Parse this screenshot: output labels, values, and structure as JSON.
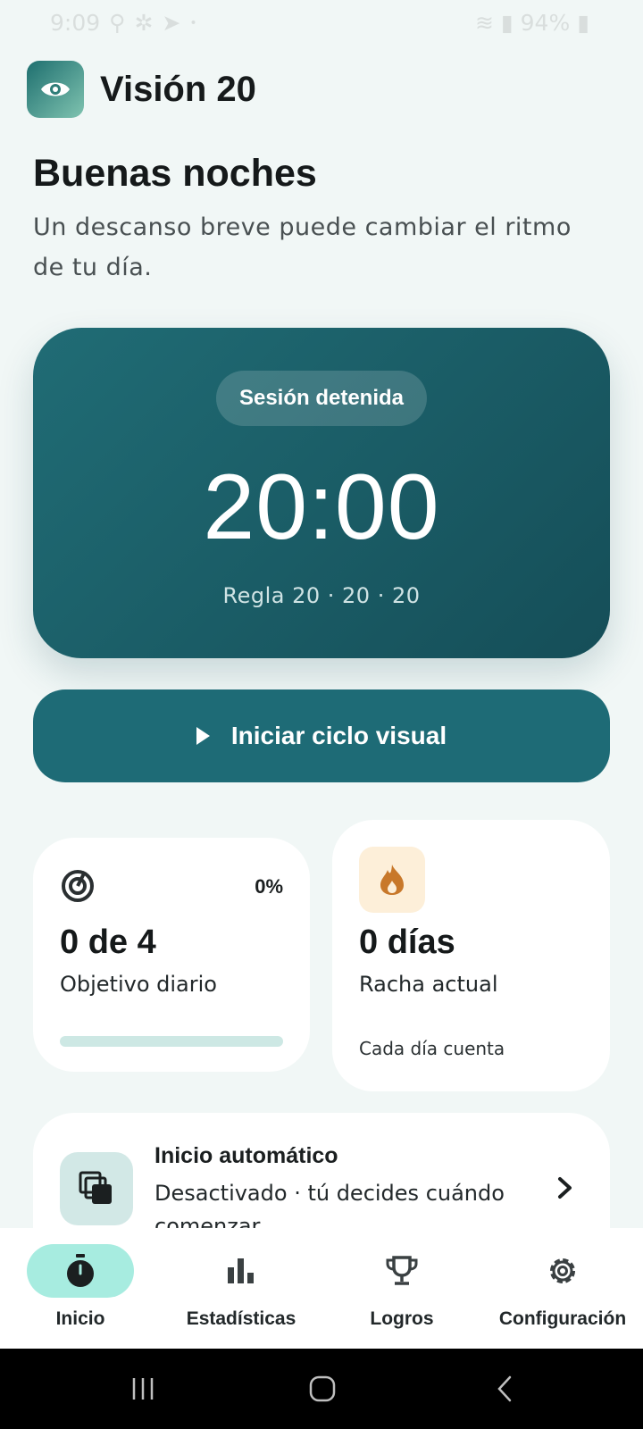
{
  "status_bar": {
    "time": "9:09",
    "battery": "94%"
  },
  "app": {
    "title": "Visión 20"
  },
  "greeting": {
    "title": "Buenas noches",
    "subtitle": "Un descanso breve puede cambiar el ritmo de tu día."
  },
  "timer": {
    "status": "Sesión detenida",
    "value": "20:00",
    "rule": "Regla 20 · 20 · 20"
  },
  "start_button": {
    "label": "Iniciar ciclo visual"
  },
  "goal_card": {
    "percent": "0%",
    "progress": 0,
    "value": "0 de 4",
    "label": "Objetivo diario"
  },
  "streak_card": {
    "value": "0 días",
    "label": "Racha actual",
    "note": "Cada día cuenta"
  },
  "auto_start": {
    "title": "Inicio automático",
    "description": "Desactivado · tú decides cuándo comenzar"
  },
  "nav": {
    "items": [
      {
        "label": "Inicio",
        "icon": "stopwatch-icon",
        "active": true
      },
      {
        "label": "Estadísticas",
        "icon": "bar-chart-icon",
        "active": false
      },
      {
        "label": "Logros",
        "icon": "trophy-icon",
        "active": false
      },
      {
        "label": "Configuración",
        "icon": "gear-icon",
        "active": false
      }
    ]
  },
  "colors": {
    "accent": "#1e6b76",
    "background": "#f1f7f6",
    "nav_active": "#a7ece0",
    "streak": "#c8782a"
  }
}
